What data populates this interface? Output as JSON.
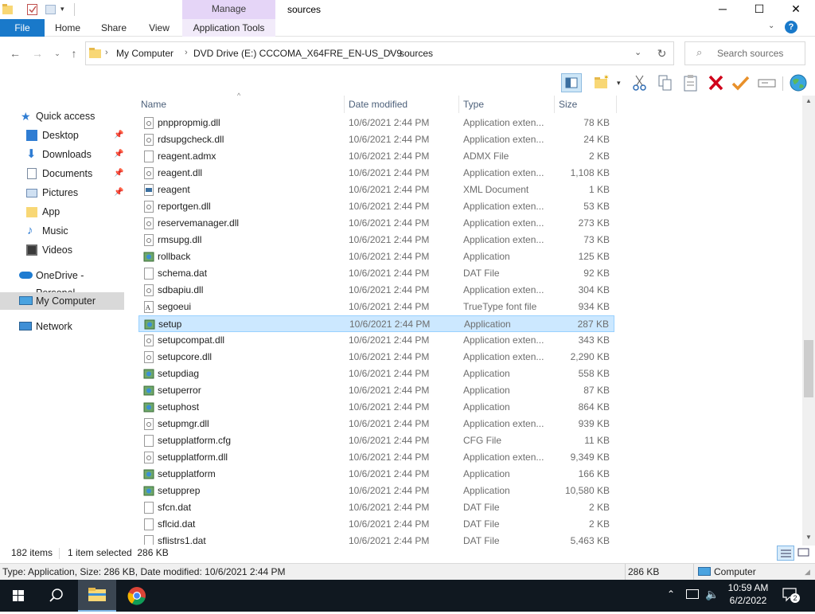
{
  "titlebar": {
    "manage_label": "Manage",
    "title": "sources",
    "minimize": "─",
    "maximize": "☐",
    "close": "✕"
  },
  "tabs": {
    "file": "File",
    "home": "Home",
    "share": "Share",
    "view": "View",
    "app_tools": "Application Tools"
  },
  "address": {
    "crumbs": [
      "My Computer",
      "DVD Drive (E:) CCCOMA_X64FRE_EN-US_DV9",
      "sources"
    ]
  },
  "search": {
    "placeholder": "Search sources"
  },
  "nav": {
    "items": [
      {
        "label": "Quick access"
      },
      {
        "label": "Desktop"
      },
      {
        "label": "Downloads"
      },
      {
        "label": "Documents"
      },
      {
        "label": "Pictures"
      },
      {
        "label": "App"
      },
      {
        "label": "Music"
      },
      {
        "label": "Videos"
      },
      {
        "label": "OneDrive - Personal"
      },
      {
        "label": "My Computer"
      },
      {
        "label": "Network"
      }
    ]
  },
  "columns": {
    "name": "Name",
    "date": "Date modified",
    "type": "Type",
    "size": "Size"
  },
  "files": [
    {
      "name": "pnppropmig.dll",
      "date": "10/6/2021 2:44 PM",
      "type": "Application exten...",
      "size": "78 KB"
    },
    {
      "name": "rdsupgcheck.dll",
      "date": "10/6/2021 2:44 PM",
      "type": "Application exten...",
      "size": "24 KB"
    },
    {
      "name": "reagent.admx",
      "date": "10/6/2021 2:44 PM",
      "type": "ADMX File",
      "size": "2 KB"
    },
    {
      "name": "reagent.dll",
      "date": "10/6/2021 2:44 PM",
      "type": "Application exten...",
      "size": "1,108 KB"
    },
    {
      "name": "reagent",
      "date": "10/6/2021 2:44 PM",
      "type": "XML Document",
      "size": "1 KB"
    },
    {
      "name": "reportgen.dll",
      "date": "10/6/2021 2:44 PM",
      "type": "Application exten...",
      "size": "53 KB"
    },
    {
      "name": "reservemanager.dll",
      "date": "10/6/2021 2:44 PM",
      "type": "Application exten...",
      "size": "273 KB"
    },
    {
      "name": "rmsupg.dll",
      "date": "10/6/2021 2:44 PM",
      "type": "Application exten...",
      "size": "73 KB"
    },
    {
      "name": "rollback",
      "date": "10/6/2021 2:44 PM",
      "type": "Application",
      "size": "125 KB"
    },
    {
      "name": "schema.dat",
      "date": "10/6/2021 2:44 PM",
      "type": "DAT File",
      "size": "92 KB"
    },
    {
      "name": "sdbapiu.dll",
      "date": "10/6/2021 2:44 PM",
      "type": "Application exten...",
      "size": "304 KB"
    },
    {
      "name": "segoeui",
      "date": "10/6/2021 2:44 PM",
      "type": "TrueType font file",
      "size": "934 KB"
    },
    {
      "name": "setup",
      "date": "10/6/2021 2:44 PM",
      "type": "Application",
      "size": "287 KB"
    },
    {
      "name": "setupcompat.dll",
      "date": "10/6/2021 2:44 PM",
      "type": "Application exten...",
      "size": "343 KB"
    },
    {
      "name": "setupcore.dll",
      "date": "10/6/2021 2:44 PM",
      "type": "Application exten...",
      "size": "2,290 KB"
    },
    {
      "name": "setupdiag",
      "date": "10/6/2021 2:44 PM",
      "type": "Application",
      "size": "558 KB"
    },
    {
      "name": "setuperror",
      "date": "10/6/2021 2:44 PM",
      "type": "Application",
      "size": "87 KB"
    },
    {
      "name": "setuphost",
      "date": "10/6/2021 2:44 PM",
      "type": "Application",
      "size": "864 KB"
    },
    {
      "name": "setupmgr.dll",
      "date": "10/6/2021 2:44 PM",
      "type": "Application exten...",
      "size": "939 KB"
    },
    {
      "name": "setupplatform.cfg",
      "date": "10/6/2021 2:44 PM",
      "type": "CFG File",
      "size": "11 KB"
    },
    {
      "name": "setupplatform.dll",
      "date": "10/6/2021 2:44 PM",
      "type": "Application exten...",
      "size": "9,349 KB"
    },
    {
      "name": "setupplatform",
      "date": "10/6/2021 2:44 PM",
      "type": "Application",
      "size": "166 KB"
    },
    {
      "name": "setupprep",
      "date": "10/6/2021 2:44 PM",
      "type": "Application",
      "size": "10,580 KB"
    },
    {
      "name": "sfcn.dat",
      "date": "10/6/2021 2:44 PM",
      "type": "DAT File",
      "size": "2 KB"
    },
    {
      "name": "sflcid.dat",
      "date": "10/6/2021 2:44 PM",
      "type": "DAT File",
      "size": "2 KB"
    },
    {
      "name": "sflistrs1.dat",
      "date": "10/6/2021 2:44 PM",
      "type": "DAT File",
      "size": "5,463 KB"
    }
  ],
  "selected_file": "setup",
  "status": {
    "count": "182 items",
    "selection": "1 item selected  286 KB",
    "details": "Type: Application, Size: 286 KB, Date modified: 10/6/2021 2:44 PM",
    "size": "286 KB",
    "location": "Computer"
  },
  "taskbar": {
    "time": "10:59 AM",
    "date": "6/2/2022",
    "notifications": "2"
  },
  "colors": {
    "file_tab": "#1979ca",
    "manage": "#e5d5f7",
    "selection": "#cce8ff",
    "taskbar": "#101820"
  }
}
